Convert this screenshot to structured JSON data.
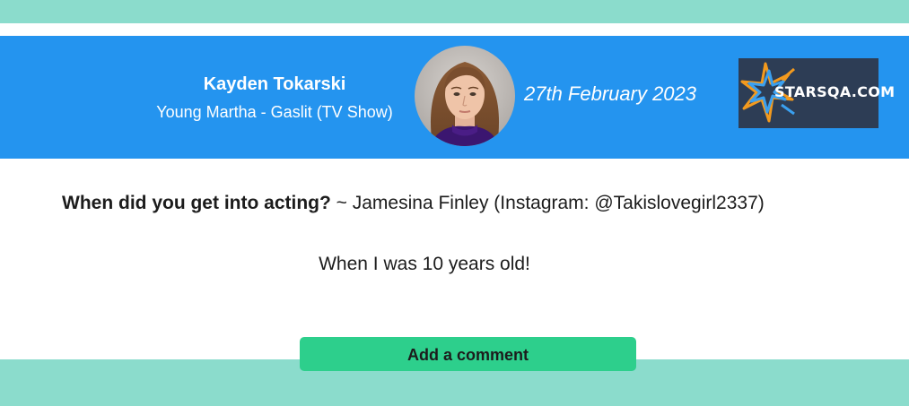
{
  "header": {
    "person_name": "Kayden Tokarski",
    "person_role": "Young Martha - Gaslit (TV Show)",
    "date": "27th February 2023",
    "logo_text": "STARSQA.COM"
  },
  "qa": {
    "question": "When did you get into acting?",
    "separator": " ~ ",
    "asker": "Jamesina Finley (Instagram: @Takislovegirl2337)",
    "answer": "When I was 10 years old!"
  },
  "actions": {
    "add_comment_label": "Add a comment"
  },
  "colors": {
    "background_teal": "#8bdccc",
    "header_blue": "#2494ef",
    "button_green": "#2dcf8c",
    "logo_navy": "#2d3d55",
    "logo_orange": "#f39a1e",
    "logo_blue": "#3aa0f0"
  },
  "icons": {
    "avatar": "profile-photo",
    "logo_burst": "starburst-icon"
  }
}
